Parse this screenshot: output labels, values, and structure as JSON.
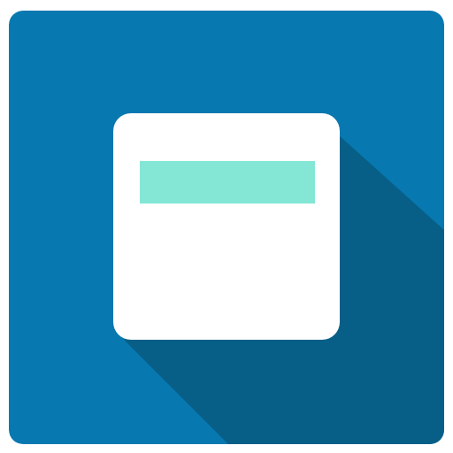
{
  "icon": {
    "name": "calendar-app-icon",
    "colors": {
      "background": "#0878b0",
      "long_shadow": "#075f88",
      "card": "#ffffff",
      "header_bar": "#84e6d5"
    }
  }
}
